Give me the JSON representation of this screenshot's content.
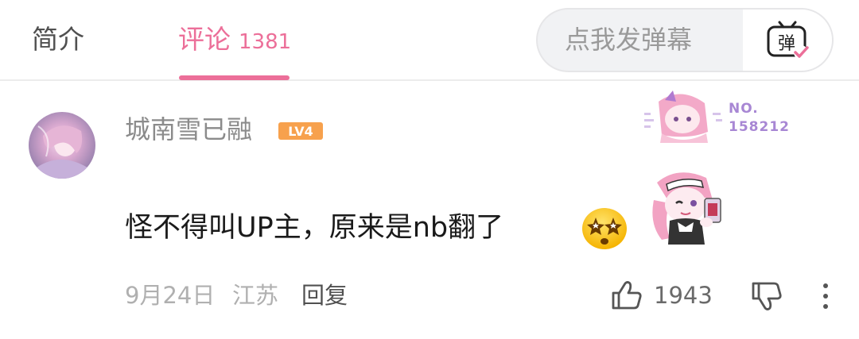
{
  "tabs": {
    "intro_label": "简介",
    "comments_label": "评论",
    "comments_count": "1381"
  },
  "danmaku": {
    "placeholder": "点我发弹幕",
    "icon_label": "弹"
  },
  "comment": {
    "username": "城南雪已融",
    "level": "LV4",
    "fan_badge": {
      "prefix": "NO.",
      "number": "158212"
    },
    "text": "怪不得叫UP主，原来是nb翻了",
    "date": "9月24日",
    "location": "江苏",
    "reply_label": "回复",
    "like_count": "1943"
  },
  "colors": {
    "accent_pink": "#ec6f99",
    "level_badge": "#f7a14d",
    "fan_badge": "#a887d4"
  },
  "icons": {
    "danmaku": "danmaku-send-icon",
    "like": "thumbs-up-icon",
    "dislike": "thumbs-down-icon",
    "more": "more-vertical-icon",
    "emoji": "starry-eyes-emoji-icon"
  }
}
